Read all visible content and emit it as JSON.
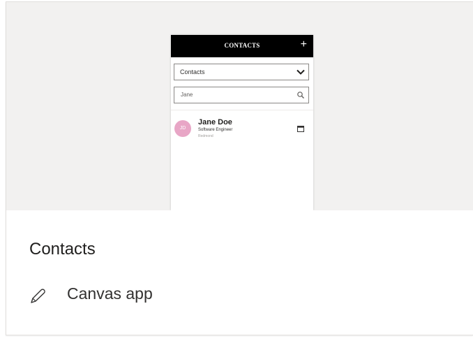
{
  "card": {
    "app_name": "Contacts",
    "app_type": "Canvas app",
    "app_type_icon": "pencil-icon"
  },
  "preview": {
    "header_title": "CONTACTS",
    "add_icon": "plus-icon",
    "dropdown": {
      "selected": "Contacts",
      "icon": "chevron-down-icon"
    },
    "search": {
      "value": "Jane",
      "icon": "search-icon"
    },
    "contacts": [
      {
        "initials": "JD",
        "name": "Jane Doe",
        "title": "Software Engineer",
        "location": "Redmond",
        "icon": "calendar-icon"
      }
    ]
  },
  "colors": {
    "preview_background": "#f2f1f0",
    "phone_header": "#000000",
    "avatar": "#e8a6c6"
  }
}
